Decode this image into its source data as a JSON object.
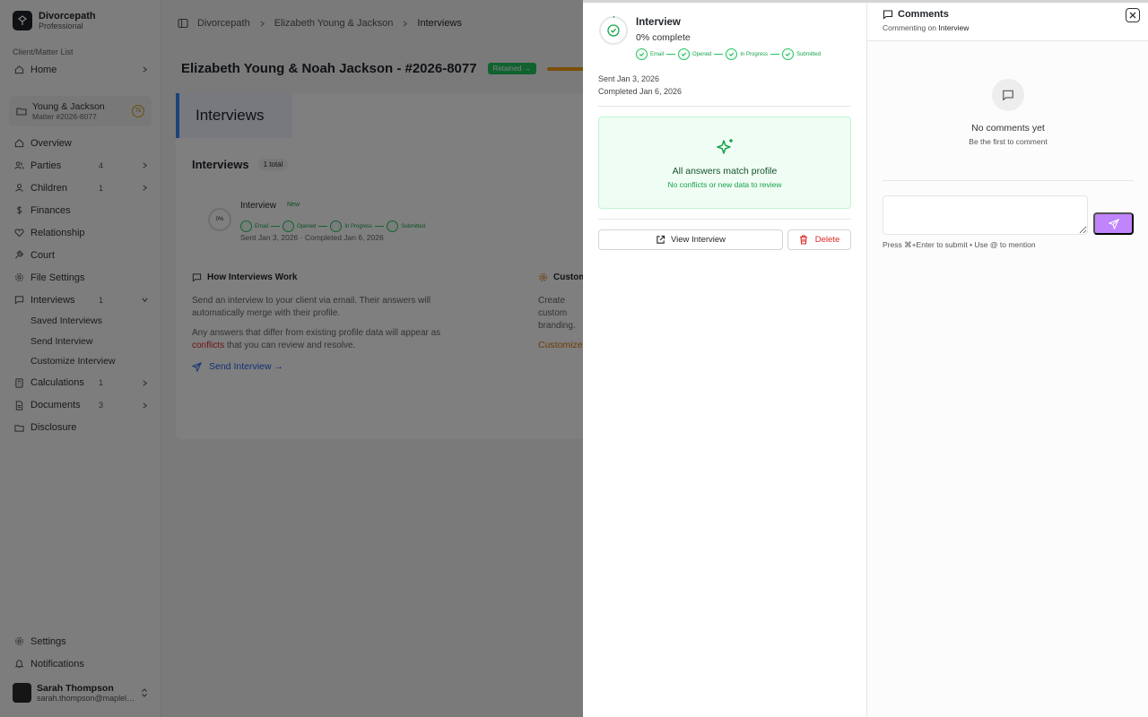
{
  "sidebar": {
    "brand_name": "Divorcepath",
    "brand_plan": "Professional",
    "section_label": "Client/Matter List",
    "home": "Home",
    "matter": {
      "title": "Young & Jackson",
      "number": "Matter #2026-8077",
      "badge": "75"
    },
    "nav": [
      {
        "label": "Overview",
        "count": ""
      },
      {
        "label": "Parties",
        "count": "4"
      },
      {
        "label": "Children",
        "count": "1"
      },
      {
        "label": "Finances",
        "count": ""
      },
      {
        "label": "Relationship",
        "count": ""
      },
      {
        "label": "Court",
        "count": ""
      },
      {
        "label": "File Settings",
        "count": ""
      },
      {
        "label": "Interviews",
        "count": "1"
      }
    ],
    "interview_sub": [
      "Saved Interviews",
      "Send Interview",
      "Customize Interview"
    ],
    "nav2": [
      {
        "label": "Calculations",
        "count": "1"
      },
      {
        "label": "Documents",
        "count": "3"
      },
      {
        "label": "Disclosure",
        "count": ""
      }
    ],
    "settings": "Settings",
    "notifications": "Notifications",
    "user": {
      "name": "Sarah Thompson",
      "email": "sarah.thompson@mapleleaf.law"
    }
  },
  "main": {
    "breadcrumb": [
      "Divorcepath",
      "Elizabeth Young & Jackson",
      "Interviews"
    ],
    "matter_title": "Elizabeth Young & Noah Jackson - #2026-8077",
    "status": "Retained →",
    "section_title": "Interviews",
    "list_title": "Interviews",
    "list_count": "1 total",
    "row": {
      "percent": "0%",
      "name": "Interview",
      "badge": "New",
      "dates": "Sent Jan 3, 2026 · Completed Jan 6, 2026"
    },
    "how": {
      "title": "How Interviews Work",
      "p1": "Send an interview to your client via email. Their answers will automatically merge with their profile.",
      "p2_a": "Any answers that differ from existing profile data will appear as",
      "p2_red": "conflicts",
      "p2_b": "that you can review and resolve.",
      "link": "Send Interview →"
    },
    "customize": {
      "title": "Customize",
      "text": "Create custom branding.",
      "link": "Customize"
    }
  },
  "detail": {
    "title": "Interview",
    "percent": "0% complete",
    "steps": [
      "Email",
      "Opened",
      "In Progress",
      "Submitted"
    ],
    "sent": "Sent Jan 3, 2026",
    "completed": "Completed Jan 6, 2026",
    "match_title": "All answers match profile",
    "match_sub": "No conflicts or new data to review",
    "view_button": "View Interview",
    "delete_button": "Delete"
  },
  "comments": {
    "title": "Comments",
    "commenting_on_prefix": "Commenting on",
    "commenting_on_target": "Interview",
    "empty_title": "No comments yet",
    "empty_sub": "Be the first to comment",
    "hint": "Press ⌘+Enter to submit • Use @ to mention",
    "accent": "#c084fc"
  }
}
